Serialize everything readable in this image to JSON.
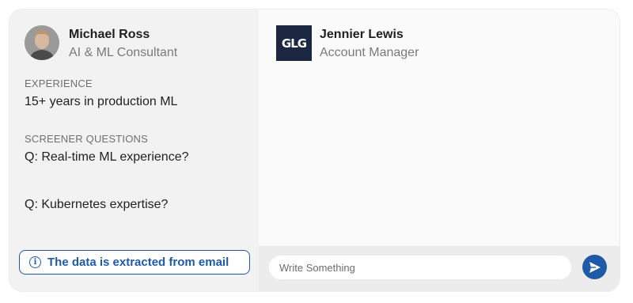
{
  "profile": {
    "name": "Michael Ross",
    "title": "AI & ML Consultant",
    "experience_label": "EXPERIENCE",
    "experience_value": "15+ years in production ML",
    "screener_label": "SCREENER QUESTIONS",
    "questions": [
      "Q: Real-time ML experience?",
      "Q: Kubernetes expertise?"
    ],
    "info_note": "The data is extracted from email"
  },
  "contact": {
    "logo_text": "GLG",
    "name": "Jennier Lewis",
    "title": "Account Manager"
  },
  "composer": {
    "placeholder": "Write Something"
  },
  "colors": {
    "accent": "#1e5aa8",
    "logo_bg": "#1b2741"
  },
  "icons": {
    "info": "info-circle-icon",
    "send": "send-icon"
  }
}
